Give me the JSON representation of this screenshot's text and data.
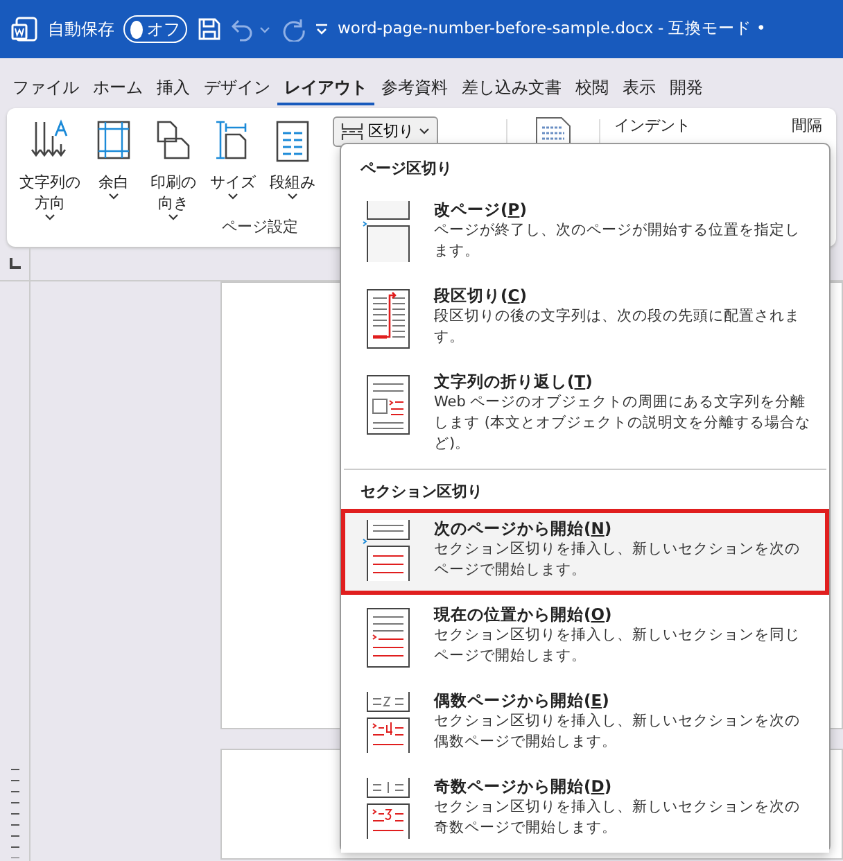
{
  "title_bar": {
    "autosave_label": "自動保存",
    "autosave_toggle": {
      "label": "オフ",
      "on": false
    },
    "file_name": "word-page-number-before-sample.docx",
    "separator": "-",
    "mode": "互換モード •"
  },
  "tabs": [
    {
      "label": "ファイル",
      "selected": false
    },
    {
      "label": "ホーム",
      "selected": false
    },
    {
      "label": "挿入",
      "selected": false
    },
    {
      "label": "デザイン",
      "selected": false
    },
    {
      "label": "レイアウト",
      "selected": true
    },
    {
      "label": "参考資料",
      "selected": false
    },
    {
      "label": "差し込み文書",
      "selected": false
    },
    {
      "label": "校閲",
      "selected": false
    },
    {
      "label": "表示",
      "selected": false
    },
    {
      "label": "開発",
      "selected": false
    }
  ],
  "ribbon": {
    "page_setup": {
      "buttons": [
        {
          "kind": "direction",
          "lines": [
            "文字列の",
            "方向"
          ]
        },
        {
          "kind": "margins",
          "lines": [
            "余白"
          ]
        },
        {
          "kind": "orientation",
          "lines": [
            "印刷の",
            "向き"
          ]
        },
        {
          "kind": "size",
          "lines": [
            "サイズ"
          ]
        },
        {
          "kind": "columns",
          "lines": [
            "段組み"
          ]
        }
      ],
      "breaks_button": "区切り",
      "group_label": "ページ設定"
    },
    "paragraph": {
      "indent_label": "インデント",
      "spacing_label": "間隔"
    }
  },
  "breaks_menu": {
    "sections": [
      {
        "header": "ページ区切り",
        "items": [
          {
            "kind": "page",
            "title": "改ページ(P)",
            "description": "ページが終了し、次のページが開始する位置を指定します。",
            "selected": false
          },
          {
            "kind": "column",
            "title": "段区切り(C)",
            "description": "段区切りの後の文字列は、次の段の先頭に配置されます。",
            "selected": false
          },
          {
            "kind": "wrap",
            "title": "文字列の折り返し(T)",
            "description": "Web ページのオブジェクトの周囲にある文字列を分離します (本文とオブジェクトの説明文を分離する場合など)。",
            "selected": false
          }
        ]
      },
      {
        "header": "セクション区切り",
        "items": [
          {
            "kind": "next_page",
            "title": "次のページから開始(N)",
            "description": "セクション区切りを挿入し、新しいセクションを次のページで開始します。",
            "selected": true
          },
          {
            "kind": "continuous",
            "title": "現在の位置から開始(O)",
            "description": "セクション区切りを挿入し、新しいセクションを同じページで開始します。",
            "selected": false
          },
          {
            "kind": "even",
            "title": "偶数ページから開始(E)",
            "description": "セクション区切りを挿入し、新しいセクションを次の偶数ページで開始します。",
            "selected": false
          },
          {
            "kind": "odd",
            "title": "奇数ページから開始(D)",
            "description": "セクション区切りを挿入し、新しいセクションを次の奇数ページで開始します。",
            "selected": false
          }
        ]
      }
    ]
  }
}
